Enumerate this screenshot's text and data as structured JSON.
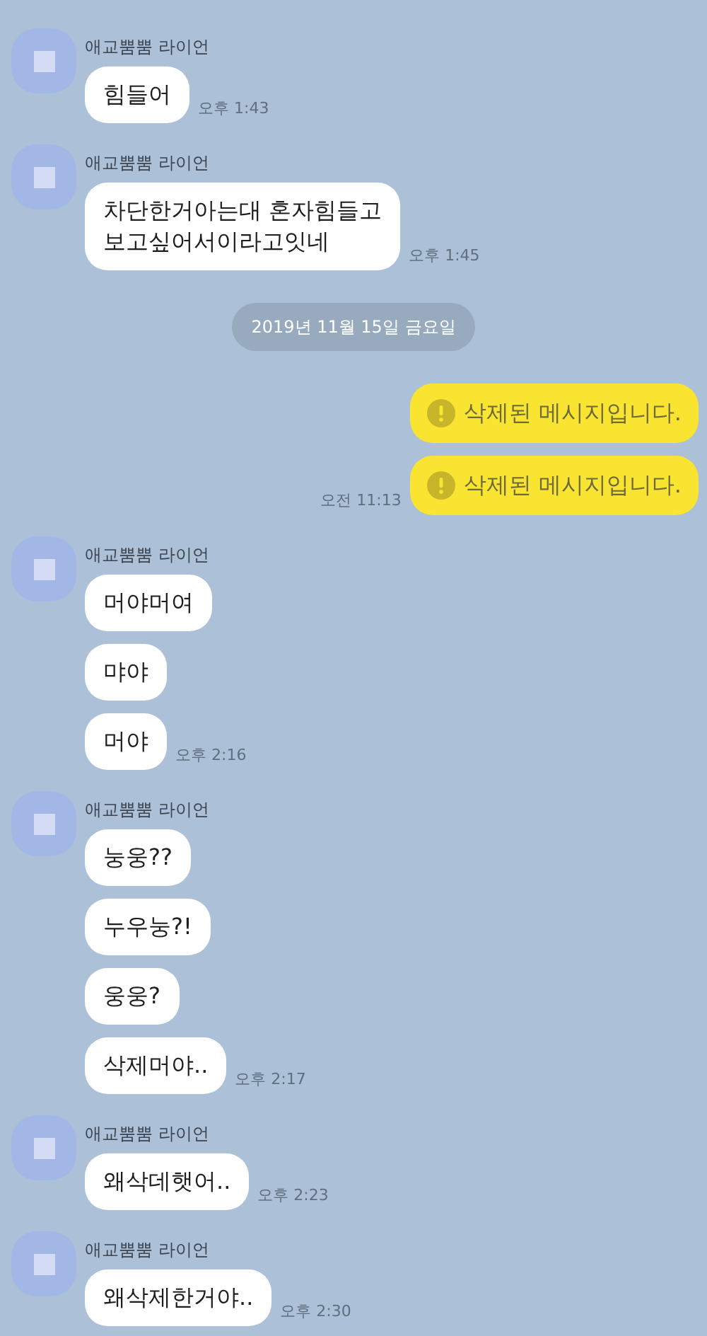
{
  "chat": [
    {
      "kind": "incoming",
      "sender": "애교뿜뿜 라이언",
      "messages": [
        "힘들어"
      ],
      "time": "오후 1:43"
    },
    {
      "kind": "incoming",
      "sender": "애교뿜뿜 라이언",
      "messages": [
        "차단한거아는대 혼자힘들고\n보고싶어서이라고잇네"
      ],
      "time": "오후 1:45"
    },
    {
      "kind": "date",
      "text": "2019년 11월 15일 금요일"
    },
    {
      "kind": "outgoing",
      "messages": [
        {
          "text": "삭제된 메시지입니다.",
          "deleted": true
        },
        {
          "text": "삭제된 메시지입니다.",
          "deleted": true
        }
      ],
      "time": "오전 11:13"
    },
    {
      "kind": "incoming",
      "sender": "애교뿜뿜 라이언",
      "messages": [
        "머야머여",
        "먀야",
        "머야"
      ],
      "time": "오후 2:16"
    },
    {
      "kind": "incoming",
      "sender": "애교뿜뿜 라이언",
      "messages": [
        "눙웅??",
        "누우눙?!",
        "웅웅?",
        "삭제머야.."
      ],
      "time": "오후 2:17"
    },
    {
      "kind": "incoming",
      "sender": "애교뿜뿜 라이언",
      "messages": [
        "왜삭데햇어.."
      ],
      "time": "오후 2:23"
    },
    {
      "kind": "incoming",
      "sender": "애교뿜뿜 라이언",
      "messages": [
        "왜삭제한거야.."
      ],
      "time": "오후 2:30"
    }
  ]
}
